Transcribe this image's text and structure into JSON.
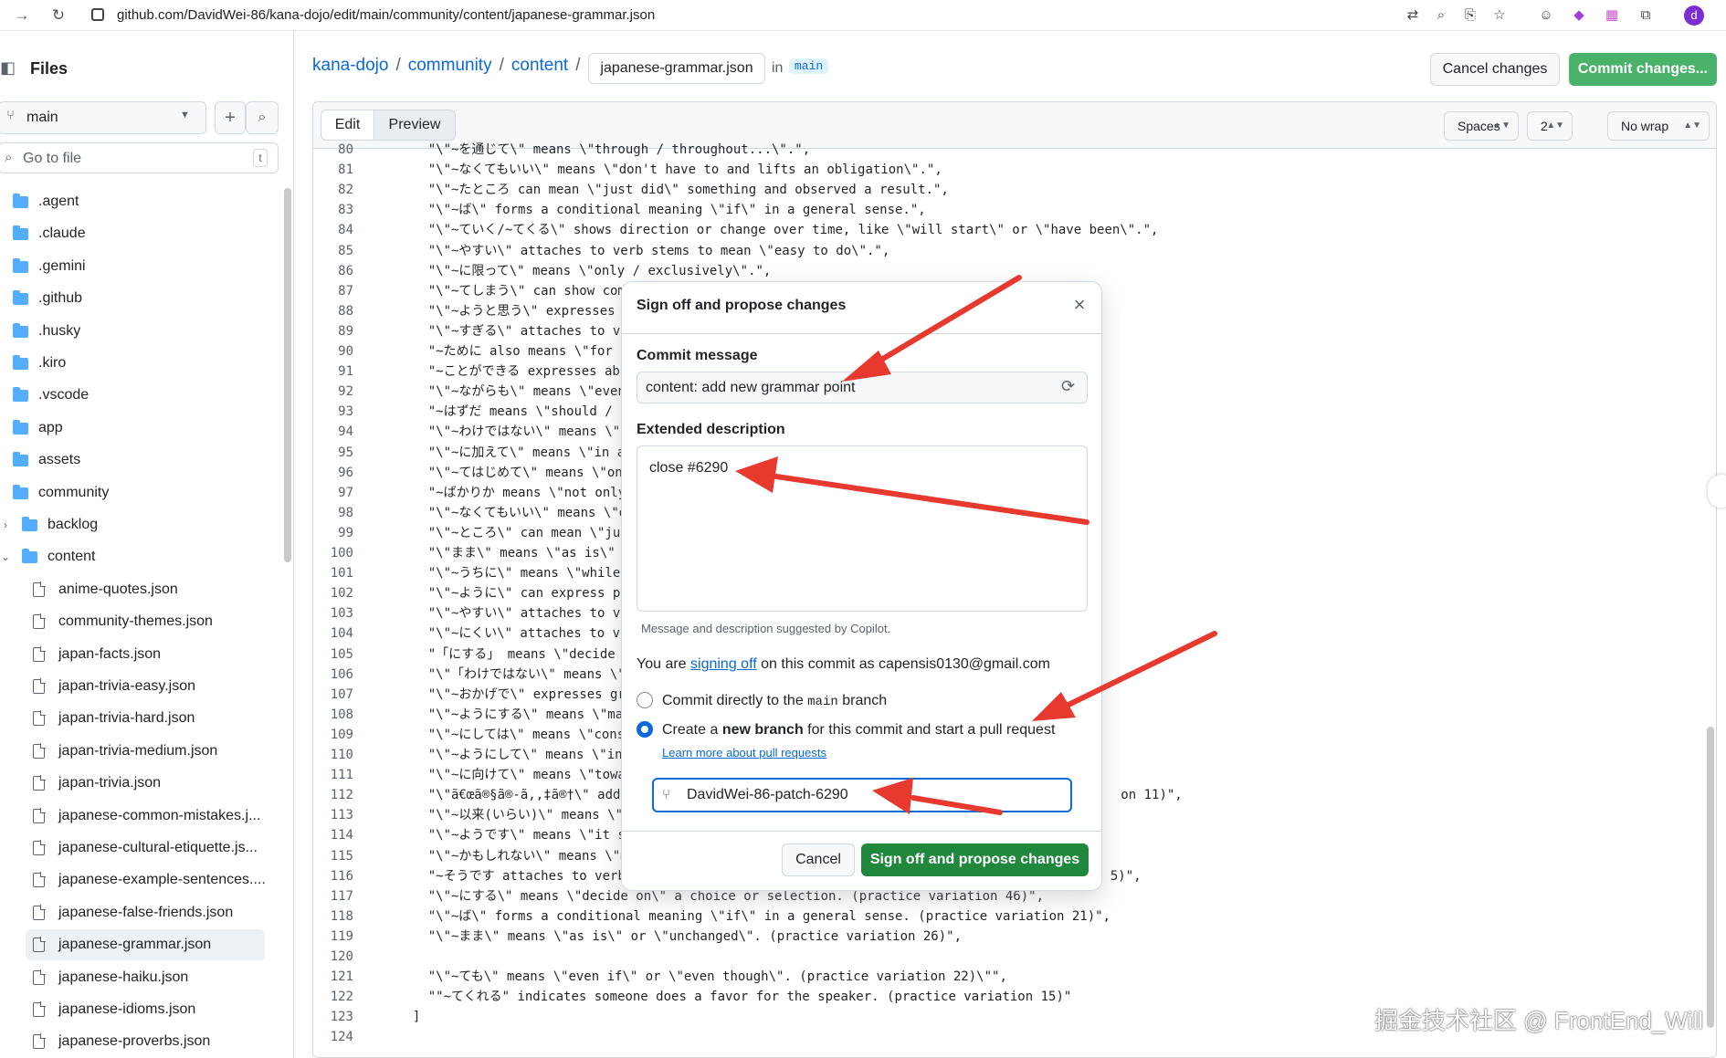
{
  "browser": {
    "url": "github.com/DavidWei-86/kana-dojo/edit/main/community/content/japanese-grammar.json",
    "avatar_letter": "d"
  },
  "sidebar": {
    "title": "Files",
    "branch": "main",
    "search_placeholder": "Go to file",
    "search_shortcut": "t",
    "tree": [
      {
        "label": ".agent",
        "type": "folder",
        "depth": 0
      },
      {
        "label": ".claude",
        "type": "folder",
        "depth": 0
      },
      {
        "label": ".gemini",
        "type": "folder",
        "depth": 0
      },
      {
        "label": ".github",
        "type": "folder",
        "depth": 0
      },
      {
        "label": ".husky",
        "type": "folder",
        "depth": 0
      },
      {
        "label": ".kiro",
        "type": "folder",
        "depth": 0
      },
      {
        "label": ".vscode",
        "type": "folder",
        "depth": 0
      },
      {
        "label": "app",
        "type": "folder",
        "depth": 0
      },
      {
        "label": "assets",
        "type": "folder",
        "depth": 0
      },
      {
        "label": "community",
        "type": "folder-open",
        "depth": 0
      },
      {
        "label": "backlog",
        "type": "folder",
        "depth": 1,
        "chevron": "›"
      },
      {
        "label": "content",
        "type": "folder-open",
        "depth": 1,
        "chevron": "⌄"
      },
      {
        "label": "anime-quotes.json",
        "type": "file",
        "depth": 2
      },
      {
        "label": "community-themes.json",
        "type": "file",
        "depth": 2
      },
      {
        "label": "japan-facts.json",
        "type": "file",
        "depth": 2
      },
      {
        "label": "japan-trivia-easy.json",
        "type": "file",
        "depth": 2
      },
      {
        "label": "japan-trivia-hard.json",
        "type": "file",
        "depth": 2
      },
      {
        "label": "japan-trivia-medium.json",
        "type": "file",
        "depth": 2
      },
      {
        "label": "japan-trivia.json",
        "type": "file",
        "depth": 2
      },
      {
        "label": "japanese-common-mistakes.j...",
        "type": "file",
        "depth": 2
      },
      {
        "label": "japanese-cultural-etiquette.js...",
        "type": "file",
        "depth": 2
      },
      {
        "label": "japanese-example-sentences....",
        "type": "file",
        "depth": 2
      },
      {
        "label": "japanese-false-friends.json",
        "type": "file",
        "depth": 2
      },
      {
        "label": "japanese-grammar.json",
        "type": "file",
        "depth": 2,
        "selected": true
      },
      {
        "label": "japanese-haiku.json",
        "type": "file",
        "depth": 2
      },
      {
        "label": "japanese-idioms.json",
        "type": "file",
        "depth": 2
      },
      {
        "label": "japanese-proverbs.json",
        "type": "file",
        "depth": 2
      }
    ]
  },
  "header": {
    "crumbs": [
      "kana-dojo",
      "community",
      "content"
    ],
    "separator": "/",
    "filename": "japanese-grammar.json",
    "in_label": "in",
    "branch": "main",
    "cancel_label": "Cancel changes",
    "commit_label": "Commit changes..."
  },
  "editor": {
    "tab_edit": "Edit",
    "tab_preview": "Preview",
    "indent_mode": "Spaces",
    "indent_size": "2",
    "wrap_mode": "No wrap",
    "lines": [
      {
        "n": "80",
        "t": "    \"\\\"~を通じて\\\" means \\\"through / throughout...\\\".\","
      },
      {
        "n": "81",
        "t": "    \"\\\"~なくてもいい\\\" means \\\"don't have to and lifts an obligation\\\".\","
      },
      {
        "n": "82",
        "t": "    \"\\\"~たところ can mean \\\"just did\\\" something and observed a result.\","
      },
      {
        "n": "83",
        "t": "    \"\\\"~ば\\\" forms a conditional meaning \\\"if\\\" in a general sense.\","
      },
      {
        "n": "84",
        "t": "    \"\\\"~ていく/~てくる\\\" shows direction or change over time, like \\\"will start\\\" or \\\"have been\\\".\","
      },
      {
        "n": "85",
        "t": "    \"\\\"~やすい\\\" attaches to verb stems to mean \\\"easy to do\\\".\","
      },
      {
        "n": "86",
        "t": "    \"\\\"~に限って\\\" means \\\"only / exclusively\\\".\","
      },
      {
        "n": "87",
        "t": "    \"\\\"~てしまう\\\" can show complet"
      },
      {
        "n": "88",
        "t": "    \"\\\"~ようと思う\\\" expresses a dec"
      },
      {
        "n": "89",
        "t": "    \"\\\"~すぎる\\\" attaches to verbs"
      },
      {
        "n": "90",
        "t": "    \"~ために also means \\\"for the s"
      },
      {
        "n": "91",
        "t": "    \"~ことができる expresses ability"
      },
      {
        "n": "92",
        "t": "    \"\\\"~ながらも\\\" means \\\"even whi"
      },
      {
        "n": "93",
        "t": "    \"~はずだ means \\\"should / is su"
      },
      {
        "n": "94",
        "t": "    \"\\\"~わけではない\\\" means \\\"not n"
      },
      {
        "n": "95",
        "t": "    \"\\\"~に加えて\\\" means \\\"in addit"
      },
      {
        "n": "96",
        "t": "    \"\\\"~てはじめて\\\" means \\\"only af"
      },
      {
        "n": "97",
        "t": "    \"~ばかりか means \\\"not only... b"
      },
      {
        "n": "98",
        "t": "    \"\\\"~なくてもいい\\\" means \\\"don't"
      },
      {
        "n": "99",
        "t": "    \"\\\"~ところ\\\" can mean \\\"just di"
      },
      {
        "n": "100",
        "t": "    \"\\\"まま\\\" means \\\"as is\\\" or \\\"u"
      },
      {
        "n": "101",
        "t": "    \"\\\"~うちに\\\" means \\\"while\\\" or"
      },
      {
        "n": "102",
        "t": "    \"\\\"~ように\\\" can express purpos"
      },
      {
        "n": "103",
        "t": "    \"\\\"~やすい\\\" attaches to verb s"
      },
      {
        "n": "104",
        "t": "    \"\\\"~にくい\\\" attaches to verb s"
      },
      {
        "n": "105",
        "t": "    \"「にする」 means \\\"decide on\\\" a"
      },
      {
        "n": "106",
        "t": "    \"\\\"「わけではない\\\" means \\\"not m"
      },
      {
        "n": "107",
        "t": "    \"\\\"~おかげで\\\" expresses gratit"
      },
      {
        "n": "108",
        "t": "    \"\\\"~ようにする\\\" means \\\"make an"
      },
      {
        "n": "109",
        "t": "    \"\\\"~にしては\\\" means \\\"consider"
      },
      {
        "n": "110",
        "t": "    \"\\\"~ようにして\\\" means \\\"in orde"
      },
      {
        "n": "111",
        "t": "    \"\\\"~に向けて\\\" means \\\"toward /"
      },
      {
        "n": "112",
        "t": "    \"\\\"ã€œã®§ã®-ã‚,‡ã®†\\\" adds proba                                                          on 11)\","
      },
      {
        "n": "113",
        "t": "    \"\\\"~以来(いらい)\\\" means \\\"since"
      },
      {
        "n": "114",
        "t": "    \"\\\"~ようです\\\" means \\\"it seems"
      },
      {
        "n": "115",
        "t": "    \"\\\"~かもしれない\\\" means \\\"might"
      },
      {
        "n": "116",
        "t": "    \"~そうです attaches to verbs/adj                                                          5)\","
      },
      {
        "n": "117",
        "t": "    \"\\\"~にする\\\" means \\\"decide on\\\" a choice or selection. (practice variation 46)\","
      },
      {
        "n": "118",
        "t": "    \"\\\"~ば\\\" forms a conditional meaning \\\"if\\\" in a general sense. (practice variation 21)\","
      },
      {
        "n": "119",
        "t": "    \"\\\"~まま\\\" means \\\"as is\\\" or \\\"unchanged\\\". (practice variation 26)\","
      },
      {
        "n": "120",
        "t": ""
      },
      {
        "n": "121",
        "t": "    \"\\\"~ても\\\" means \\\"even if\\\" or \\\"even though\\\". (practice variation 22)\\\"\","
      },
      {
        "n": "122",
        "t": "    \"\"~てくれる\" indicates someone does a favor for the speaker. (practice variation 15)\""
      },
      {
        "n": "123",
        "t": "  ]"
      },
      {
        "n": "124",
        "t": ""
      }
    ]
  },
  "modal": {
    "title": "Sign off and propose changes",
    "commit_message_label": "Commit message",
    "commit_message_value": "content: add new grammar point",
    "ext_desc_label": "Extended description",
    "ext_desc_value": "close #6290",
    "hint": "Message and description suggested by Copilot.",
    "sign_prefix": "You are ",
    "sign_link": "signing off",
    "sign_suffix": " on this commit as capensis0130@gmail.com",
    "opt1_prefix": "Commit directly to the ",
    "opt1_branch": "main",
    "opt1_suffix": " branch",
    "opt2_prefix": "Create a ",
    "opt2_bold": "new branch",
    "opt2_suffix": " for this commit and start a pull request",
    "learn_more": "Learn more about pull requests",
    "new_branch_value": "DavidWei-86-patch-6290",
    "cancel_label": "Cancel",
    "submit_label": "Sign off and propose changes"
  },
  "watermark": "掘金技术社区 @ FrontEnd_Will",
  "colors": {
    "accent": "#0969da",
    "primary_green": "#1f883d",
    "annotation_arrow": "#e8392f"
  }
}
